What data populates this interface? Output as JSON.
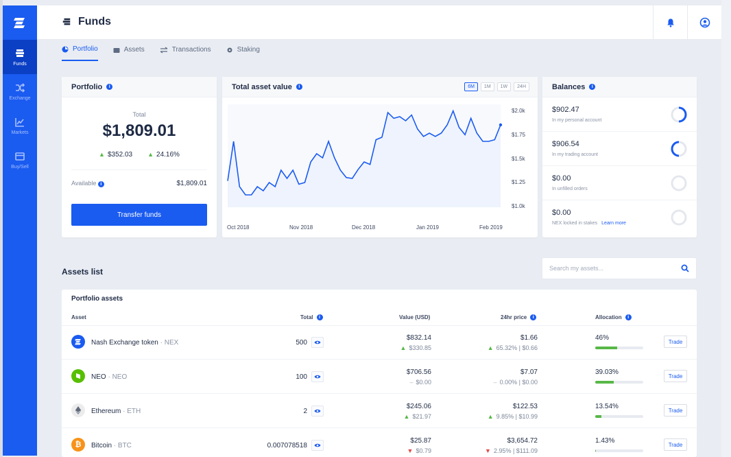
{
  "app": {
    "title": "Funds"
  },
  "sidebar": {
    "items": [
      {
        "label": "Funds",
        "icon": "wallet-icon",
        "active": true
      },
      {
        "label": "Exchange",
        "icon": "shuffle-icon",
        "active": false
      },
      {
        "label": "Markets",
        "icon": "line-chart-icon",
        "active": false
      },
      {
        "label": "Buy/Sell",
        "icon": "card-icon",
        "active": false
      }
    ]
  },
  "tabs": [
    {
      "label": "Portfolio",
      "icon": "pie-icon",
      "active": true
    },
    {
      "label": "Assets",
      "icon": "wallet-icon",
      "active": false
    },
    {
      "label": "Transactions",
      "icon": "arrows-icon",
      "active": false
    },
    {
      "label": "Staking",
      "icon": "gear-icon",
      "active": false
    }
  ],
  "portfolio": {
    "title": "Portfolio",
    "total_label": "Total",
    "total": "$1,809.01",
    "change_value": "$352.03",
    "change_pct": "24.16%",
    "available_label": "Available",
    "available_value": "$1,809.01",
    "transfer_label": "Transfer funds"
  },
  "chart_card": {
    "title": "Total asset value",
    "ranges": [
      "6M",
      "1M",
      "1W",
      "24H"
    ],
    "active_range": "6M"
  },
  "chart_data": {
    "type": "line",
    "title": "Total asset value",
    "x_ticks": [
      "Oct 2018",
      "Nov 2018",
      "Dec 2018",
      "Jan 2019",
      "Feb 2019"
    ],
    "y_ticks": [
      "$2.0k",
      "$1.75",
      "$1.5k",
      "$1.25",
      "$1.0k"
    ],
    "ylim": [
      1000,
      2000
    ],
    "series": [
      {
        "values": [
          1220,
          1700,
          1150,
          1050,
          1050,
          1150,
          1100,
          1200,
          1150,
          1350,
          1250,
          1350,
          1180,
          1200,
          1450,
          1550,
          1500,
          1700,
          1500,
          1350,
          1260,
          1250,
          1360,
          1450,
          1420,
          1720,
          1750,
          2050,
          1980,
          2000,
          1950,
          2020,
          1850,
          1760,
          1800,
          1760,
          1800,
          1900,
          2070,
          1870,
          1780,
          1980,
          1800,
          1700,
          1700,
          1720,
          1900
        ]
      }
    ],
    "color": "#1a5bf0"
  },
  "balances": {
    "title": "Balances",
    "items": [
      {
        "value": "$902.47",
        "label": "In my personal account",
        "ratio": 0.5
      },
      {
        "value": "$906.54",
        "label": "In my trading account",
        "ratio": 0.5
      },
      {
        "value": "$0.00",
        "label": "In unfilled orders",
        "ratio": 0
      },
      {
        "value": "$0.00",
        "label": "NEX locked in stakes",
        "link": "Learn more",
        "ratio": 0
      }
    ]
  },
  "assets": {
    "title": "Assets list",
    "search_placeholder": "Search my assets...",
    "table_title": "Portfolio assets",
    "headers": {
      "asset": "Asset",
      "total": "Total",
      "value": "Value (USD)",
      "price": "24hr price",
      "allocation": "Allocation"
    },
    "rows": [
      {
        "name": "Nash Exchange token",
        "symbol": "NEX",
        "total": "500",
        "value": "$832.14",
        "value_change": "$330.85",
        "value_dir": "up",
        "price": "$1.66",
        "price_change": "65.32% | $0.66",
        "price_dir": "up",
        "allocation": "46%",
        "alloc_ratio": 0.46,
        "coin_color": "#1a5bf0",
        "trade": "Trade"
      },
      {
        "name": "NEO",
        "symbol": "NEO",
        "total": "100",
        "value": "$706.56",
        "value_change": "$0.00",
        "value_dir": "flat",
        "price": "$7.07",
        "price_change": "0.00% | $0.00",
        "price_dir": "flat",
        "allocation": "39.03%",
        "alloc_ratio": 0.3903,
        "coin_color": "#58bf00",
        "trade": "Trade"
      },
      {
        "name": "Ethereum",
        "symbol": "ETH",
        "total": "2",
        "value": "$245.06",
        "value_change": "$21.97",
        "value_dir": "up",
        "price": "$122.53",
        "price_change": "9.85% | $10.99",
        "price_dir": "up",
        "allocation": "13.54%",
        "alloc_ratio": 0.1354,
        "coin_color": "#ececec",
        "trade": "Trade"
      },
      {
        "name": "Bitcoin",
        "symbol": "BTC",
        "total": "0.007078518",
        "value": "$25.87",
        "value_change": "$0.79",
        "value_dir": "down",
        "price": "$3,654.72",
        "price_change": "2.95% | $111.09",
        "price_dir": "down",
        "allocation": "1.43%",
        "alloc_ratio": 0.0143,
        "coin_color": "#f7931a",
        "trade": "Trade"
      }
    ]
  }
}
